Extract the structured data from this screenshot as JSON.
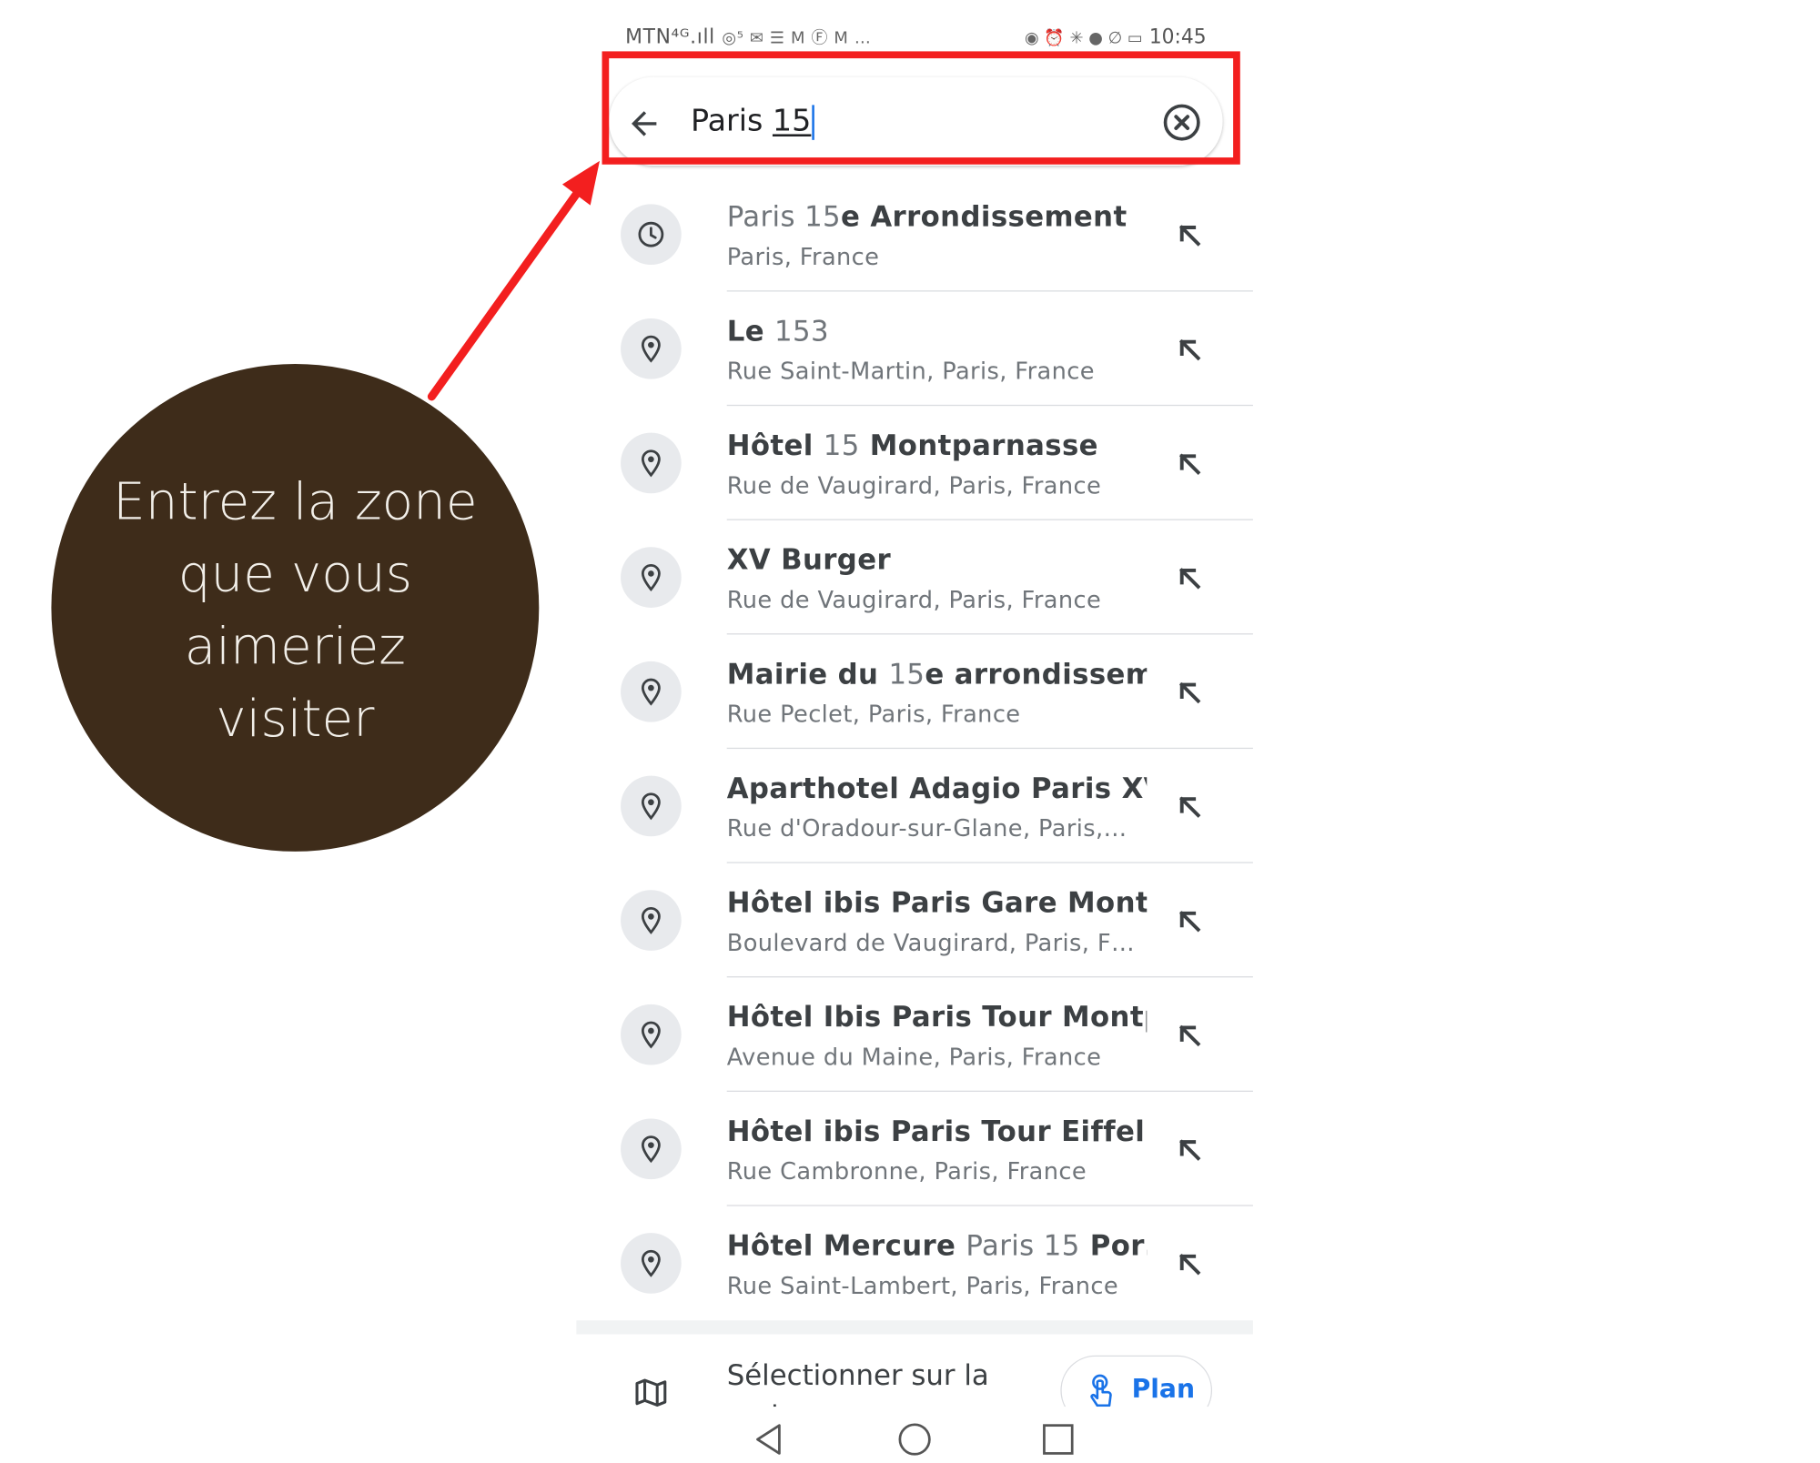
{
  "status_bar": {
    "left": "MTN⁴ᴳ.ıll",
    "left_icons": "◎⁵ ✉ ☰ M Ⓕ M …",
    "right_icons": "◉ ⏰ ✳ ● ∅ ▭",
    "time": "10:45"
  },
  "search": {
    "prefix": "Paris ",
    "typed": "15"
  },
  "results": [
    {
      "title_parts": [
        {
          "t": "Paris 15",
          "light": true
        },
        {
          "t": "e Arrondissement",
          "light": false
        }
      ],
      "subtitle": "Paris, France",
      "icon": "history-icon"
    },
    {
      "title_parts": [
        {
          "t": "Le ",
          "light": false
        },
        {
          "t": "153",
          "light": true
        }
      ],
      "subtitle": "Rue Saint-Martin, Paris, France",
      "icon": "place-icon"
    },
    {
      "title_parts": [
        {
          "t": "Hôtel ",
          "light": false
        },
        {
          "t": "15",
          "light": true
        },
        {
          "t": " Montparnasse",
          "light": false
        }
      ],
      "subtitle": "Rue de Vaugirard, Paris, France",
      "icon": "place-icon"
    },
    {
      "title_parts": [
        {
          "t": "XV Burger",
          "light": false
        }
      ],
      "subtitle": "Rue de Vaugirard, Paris, France",
      "icon": "place-icon"
    },
    {
      "title_parts": [
        {
          "t": "Mairie du ",
          "light": false
        },
        {
          "t": "15",
          "light": true
        },
        {
          "t": "e arrondissem…",
          "light": false
        }
      ],
      "subtitle": "Rue Peclet, Paris, France",
      "icon": "place-icon"
    },
    {
      "title_parts": [
        {
          "t": "Aparthotel Adagio Paris XV",
          "light": false
        }
      ],
      "subtitle": "Rue d'Oradour-sur-Glane, Paris,…",
      "icon": "place-icon"
    },
    {
      "title_parts": [
        {
          "t": "Hôtel ibis Paris Gare Montp…",
          "light": false
        }
      ],
      "subtitle": "Boulevard de Vaugirard, Paris, F…",
      "icon": "place-icon"
    },
    {
      "title_parts": [
        {
          "t": "Hôtel Ibis Paris Tour Montp…",
          "light": false
        }
      ],
      "subtitle": "Avenue du Maine, Paris, France",
      "icon": "place-icon"
    },
    {
      "title_parts": [
        {
          "t": "Hôtel ibis Paris Tour Eiffel…",
          "light": false
        }
      ],
      "subtitle": "Rue Cambronne, Paris, France",
      "icon": "place-icon"
    },
    {
      "title_parts": [
        {
          "t": "Hôtel Mercure ",
          "light": false
        },
        {
          "t": "Paris 15",
          "light": true
        },
        {
          "t": " Por…",
          "light": false
        }
      ],
      "subtitle": "Rue Saint-Lambert, Paris, France",
      "icon": "place-icon"
    }
  ],
  "bottom": {
    "select_on_map": "Sélectionner sur la carte",
    "plan_label": "Plan"
  },
  "callout": {
    "text": "Entrez la zone que vous aimeriez visiter"
  },
  "colors": {
    "highlight": "#f31f1f",
    "callout_bg": "#3e2c1a",
    "accent": "#1a73e8"
  }
}
